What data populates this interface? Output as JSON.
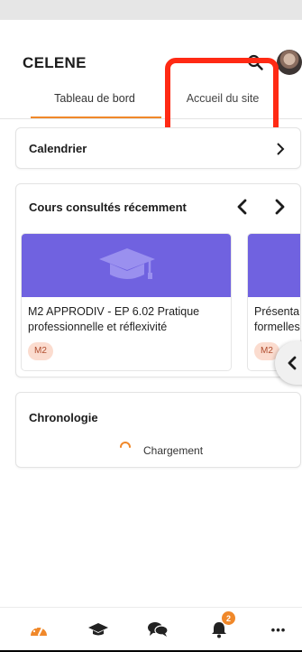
{
  "app": {
    "title": "CELENE"
  },
  "header": {
    "search_icon": "search-icon",
    "avatar_icon": "user-avatar"
  },
  "tabs": [
    {
      "label": "Tableau de bord",
      "active": true
    },
    {
      "label": "Accueil du site",
      "active": false
    }
  ],
  "calendar": {
    "title": "Calendrier",
    "icon": "chevron-right-icon"
  },
  "recent_courses": {
    "title": "Cours consultés récemment",
    "courses": [
      {
        "name_lines": [
          "M2 APPRODIV - EP 6.02 Pratique",
          "professionnelle et réflexivité"
        ],
        "badge": "M2",
        "icon": "graduation-cap-icon"
      },
      {
        "name_lines": [
          "Présenta",
          "formelles"
        ],
        "badge": "M2"
      }
    ]
  },
  "timeline": {
    "title": "Chronologie",
    "loading_text": "Chargement"
  },
  "bottom_nav": {
    "items": [
      "dashboard-icon",
      "courses-icon",
      "messages-icon",
      "notifications-icon",
      "more-icon"
    ],
    "notification_count": "2",
    "more_label": "•••"
  },
  "colors": {
    "accent": "#f0882a",
    "course_banner": "#7062e0",
    "highlight": "#ff2a14",
    "badge_bg": "#fbdccf"
  }
}
